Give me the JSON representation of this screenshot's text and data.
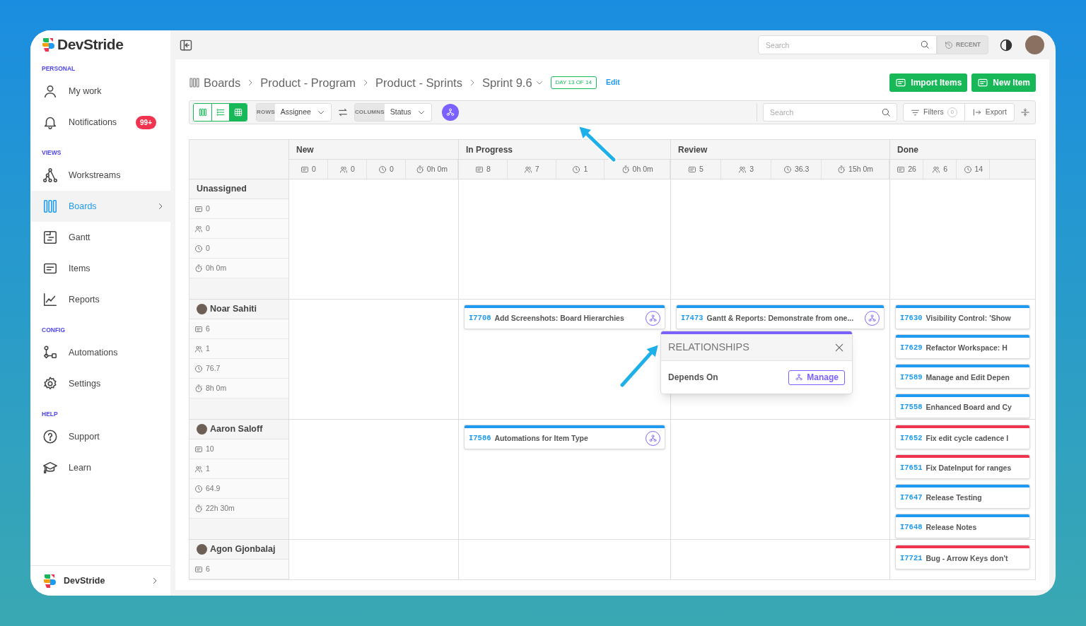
{
  "brand": {
    "name": "DevStride"
  },
  "sidebar": {
    "sections": [
      {
        "label": "PERSONAL",
        "items": [
          {
            "label": "My work",
            "selected": false
          },
          {
            "label": "Notifications",
            "badge": "99+",
            "selected": false
          }
        ]
      },
      {
        "label": "VIEWS",
        "items": [
          {
            "label": "Workstreams",
            "selected": false
          },
          {
            "label": "Boards",
            "selected": true
          },
          {
            "label": "Gantt",
            "selected": false
          },
          {
            "label": "Items",
            "selected": false
          },
          {
            "label": "Reports",
            "selected": false
          }
        ]
      },
      {
        "label": "CONFIG",
        "items": [
          {
            "label": "Automations",
            "selected": false
          },
          {
            "label": "Settings",
            "selected": false
          }
        ]
      },
      {
        "label": "HELP",
        "items": [
          {
            "label": "Support",
            "selected": false
          },
          {
            "label": "Learn",
            "selected": false
          }
        ]
      }
    ],
    "footer": {
      "label": "DevStride"
    }
  },
  "topbar": {
    "search_placeholder": "Search",
    "recent": "RECENT"
  },
  "breadcrumb": {
    "items": [
      "Boards",
      "Product - Program",
      "Product - Sprints",
      "Sprint 9.6"
    ],
    "badge": "DAY 13 OF 14",
    "edit": "Edit"
  },
  "actions": [
    "Import Items",
    "New Item"
  ],
  "toolbar": {
    "views": [
      {
        "kind": "board",
        "selected": false
      },
      {
        "kind": "list",
        "selected": false
      },
      {
        "kind": "grid",
        "selected": true
      }
    ],
    "rows_label": "ROWS",
    "rows_value": "Assignee",
    "columns_label": "COLUMNS",
    "columns_value": "Status",
    "search_placeholder": "Search",
    "filters": "Filters",
    "filters_count": "0",
    "export": "Export"
  },
  "board": {
    "columns": [
      {
        "title": "New",
        "stats": [
          "0",
          "0",
          "0",
          "0h 0m"
        ]
      },
      {
        "title": "In Progress",
        "stats": [
          "8",
          "7",
          "1",
          "0h 0m"
        ]
      },
      {
        "title": "Review",
        "stats": [
          "5",
          "3",
          "36.3",
          "15h 0m"
        ]
      },
      {
        "title": "Done",
        "stats": [
          "26",
          "6",
          "14"
        ]
      }
    ],
    "rows": [
      {
        "name": "Unassigned",
        "avatar": false,
        "stats": [
          "0",
          "0",
          "0",
          "0h 0m"
        ],
        "cells": [
          [],
          [],
          [],
          []
        ]
      },
      {
        "name": "Noar Sahiti",
        "avatar": true,
        "stats": [
          "6",
          "1",
          "76.7",
          "8h 0m"
        ],
        "cells": [
          [],
          [
            {
              "id": "I7708",
              "title": "Add Screenshots: Board Hierarchies",
              "color": "#1e9bf0",
              "has_relations": true
            }
          ],
          [
            {
              "id": "I7473",
              "title": "Gantt & Reports: Demonstrate from one...",
              "color": "#1e9bf0",
              "has_relations": true
            }
          ],
          [
            {
              "id": "I7630",
              "title": "Visibility Control: 'Show",
              "color": "#1e9bf0",
              "has_relations": false
            },
            {
              "id": "I7629",
              "title": "Refactor Workspace: H",
              "color": "#1e9bf0",
              "has_relations": false
            },
            {
              "id": "I7589",
              "title": "Manage and Edit Depen",
              "color": "#1e9bf0",
              "has_relations": false
            },
            {
              "id": "I7558",
              "title": "Enhanced Board and Cy",
              "color": "#1e9bf0",
              "has_relations": false
            }
          ]
        ]
      },
      {
        "name": "Aaron Saloff",
        "avatar": true,
        "stats": [
          "10",
          "1",
          "64.9",
          "22h 30m"
        ],
        "cells": [
          [],
          [
            {
              "id": "I7586",
              "title": "Automations for Item Type",
              "color": "#1e9bf0",
              "has_relations": true
            }
          ],
          [],
          [
            {
              "id": "I7652",
              "title": "Fix edit cycle cadence I",
              "color": "#f0344f",
              "has_relations": false
            },
            {
              "id": "I7651",
              "title": "Fix DateInput for ranges",
              "color": "#f0344f",
              "has_relations": false
            },
            {
              "id": "I7647",
              "title": "Release Testing",
              "color": "#1e9bf0",
              "has_relations": false
            },
            {
              "id": "I7648",
              "title": "Release Notes",
              "color": "#1e9bf0",
              "has_relations": false
            }
          ]
        ]
      },
      {
        "name": "Agon Gjonbalaj",
        "avatar": true,
        "stats": [
          "6"
        ],
        "cells": [
          [],
          [],
          [],
          [
            {
              "id": "I7721",
              "title": "Bug - Arrow Keys don't",
              "color": "#f0344f",
              "has_relations": false
            }
          ]
        ]
      }
    ]
  },
  "relationships_popover": {
    "title": "RELATIONSHIPS",
    "label": "Depends On",
    "button": "Manage"
  }
}
